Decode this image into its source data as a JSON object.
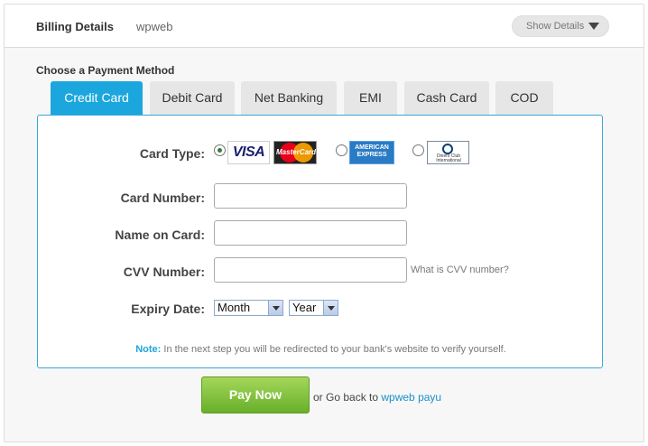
{
  "header": {
    "title": "Billing Details",
    "merchant": "wpweb",
    "show_details_label": "Show Details"
  },
  "payment": {
    "section_title": "Choose a Payment Method",
    "tabs": [
      {
        "label": "Credit Card",
        "active": true
      },
      {
        "label": "Debit Card",
        "active": false
      },
      {
        "label": "Net Banking",
        "active": false
      },
      {
        "label": "EMI",
        "active": false
      },
      {
        "label": "Cash Card",
        "active": false
      },
      {
        "label": "COD",
        "active": false
      }
    ]
  },
  "form": {
    "card_type_label": "Card Type:",
    "card_types": [
      {
        "name": "Visa / MasterCard",
        "visa_text": "VISA",
        "mc_text": "MasterCard",
        "selected": true
      },
      {
        "name": "American Express",
        "text_line1": "AMERICAN",
        "text_line2": "EXPRESS",
        "selected": false
      },
      {
        "name": "Diners Club International",
        "text": "Diners Club International",
        "selected": false
      }
    ],
    "card_number_label": "Card Number:",
    "card_number_value": "",
    "name_on_card_label": "Name on Card:",
    "name_on_card_value": "",
    "cvv_label": "CVV Number:",
    "cvv_value": "",
    "cvv_help": "What is CVV number?",
    "expiry_label": "Expiry Date:",
    "expiry_month": "Month",
    "expiry_year": "Year",
    "note_label": "Note:",
    "note_text": " In the next step you will be redirected to your bank's website to verify yourself."
  },
  "footer": {
    "pay_button": "Pay Now",
    "go_back_text": "or Go back to ",
    "go_back_link": "wpweb payu"
  },
  "colors": {
    "accent": "#1ba6dd",
    "pay_button": "#7cbd3c",
    "tab_inactive": "#e6e6e6"
  }
}
